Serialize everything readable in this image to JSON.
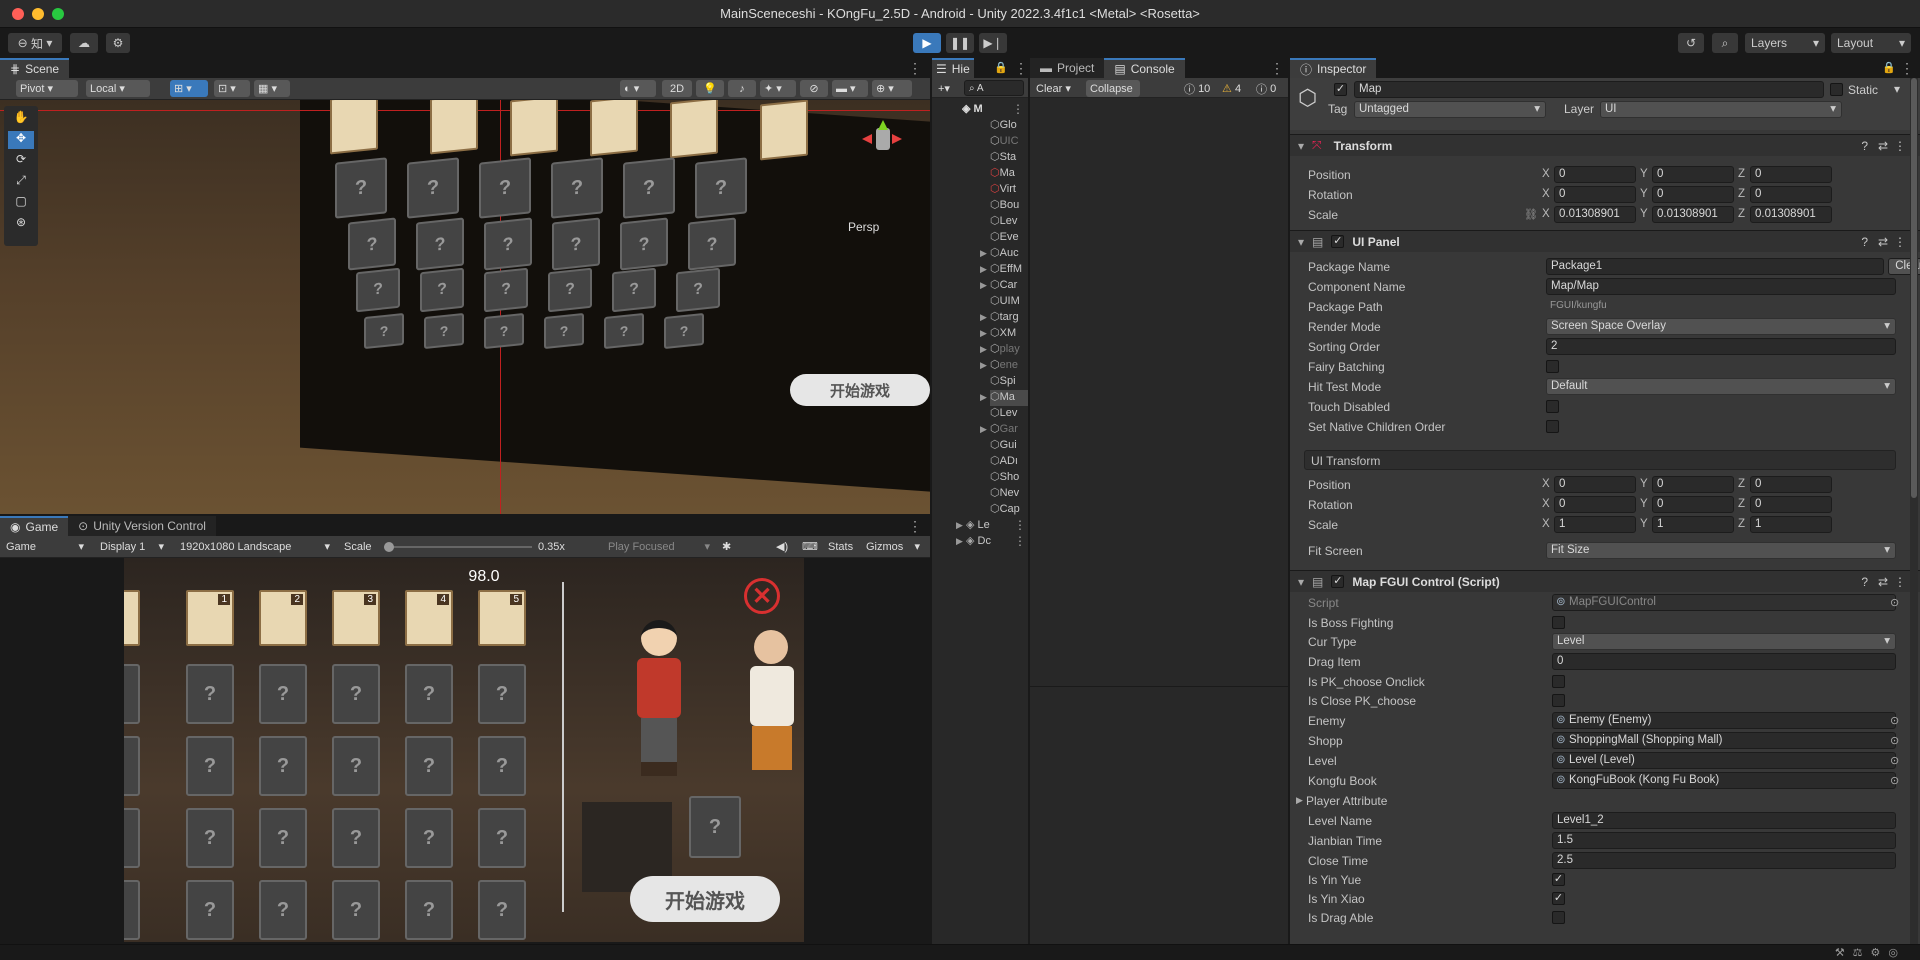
{
  "window": {
    "title": "MainSceneceshi - KOngFu_2.5D - Android - Unity 2022.3.4f1c1 <Metal> <Rosetta>"
  },
  "toolbar": {
    "account_label": "知",
    "layers_label": "Layers",
    "layout_label": "Layout"
  },
  "scene": {
    "tab_label": "Scene",
    "pivot_label": "Pivot",
    "local_label": "Local",
    "mode_2d_label": "2D",
    "persp_label": "Persp",
    "banner_text": "开始游戏"
  },
  "game": {
    "tab_label": "Game",
    "uvc_tab_label": "Unity Version Control",
    "view_label": "Game",
    "display_label": "Display 1",
    "resolution_label": "1920x1080 Landscape",
    "scale_label": "Scale",
    "scale_value": "0.35x",
    "play_focused_label": "Play Focused",
    "stats_label": "Stats",
    "gizmos_label": "Gizmos",
    "score_text": "98.0",
    "start_button_text": "开始游戏",
    "card_numbers": [
      "1",
      "2",
      "3",
      "4",
      "5"
    ],
    "unknown_glyph": "?"
  },
  "hierarchy": {
    "tab_label": "Hie",
    "search_placeholder": "A",
    "root_label": "M",
    "items": [
      "Glo",
      "UIC",
      "Sta",
      "Ma",
      "Virt",
      "Bou",
      "Lev",
      "Eve",
      "Auc",
      "EffM",
      "Car",
      "UIM",
      "targ",
      "XM",
      "play",
      "ene",
      "Spi",
      "Ma",
      "Lev",
      "Gar",
      "Gui",
      "ADı",
      "Sho",
      "Nev",
      "Cap"
    ],
    "bottom_items": [
      "Le",
      "Dc"
    ]
  },
  "project": {
    "tab_label": "Project"
  },
  "console": {
    "tab_label": "Console",
    "clear_label": "Clear",
    "collapse_label": "Collapse",
    "info_count": "10",
    "warning_count": "4",
    "error_count": "0"
  },
  "inspector": {
    "tab_label": "Inspector",
    "object_name": "Map",
    "static_label": "Static",
    "tag_label": "Tag",
    "tag_value": "Untagged",
    "layer_label": "Layer",
    "layer_value": "UI",
    "transform": {
      "title": "Transform",
      "position_label": "Position",
      "position": [
        "0",
        "0",
        "0"
      ],
      "rotation_label": "Rotation",
      "rotation": [
        "0",
        "0",
        "0"
      ],
      "scale_label": "Scale",
      "scale": [
        "0.01308901",
        "0.01308901",
        "0.01308901"
      ]
    },
    "axis_labels": [
      "X",
      "Y",
      "Z"
    ],
    "ui_panel": {
      "title": "UI Panel",
      "package_name_label": "Package Name",
      "package_name": "Package1",
      "clear_label": "Clear",
      "component_name_label": "Component Name",
      "component_name": "Map/Map",
      "package_path_label": "Package Path",
      "package_path": "FGUI/kungfu",
      "render_mode_label": "Render Mode",
      "render_mode": "Screen Space Overlay",
      "sorting_order_label": "Sorting Order",
      "sorting_order": "2",
      "fairy_batching_label": "Fairy Batching",
      "hit_test_mode_label": "Hit Test Mode",
      "hit_test_mode": "Default",
      "touch_disabled_label": "Touch Disabled",
      "native_order_label": "Set Native Children Order",
      "ui_transform_label": "UI Transform",
      "position_label": "Position",
      "position": [
        "0",
        "0",
        "0"
      ],
      "rotation_label": "Rotation",
      "rotation": [
        "0",
        "0",
        "0"
      ],
      "scale_label": "Scale",
      "scale": [
        "1",
        "1",
        "1"
      ],
      "fit_screen_label": "Fit Screen",
      "fit_screen": "Fit Size"
    },
    "map_control": {
      "title": "Map FGUI Control (Script)",
      "script_label": "Script",
      "script_value": "MapFGUIControl",
      "boss_label": "Is Boss Fighting",
      "cur_type_label": "Cur Type",
      "cur_type": "Level",
      "drag_item_label": "Drag Item",
      "drag_item": "0",
      "pk_onclick_label": "Is PK_choose Onclick",
      "close_pk_label": "Is Close PK_choose",
      "enemy_label": "Enemy",
      "enemy": "Enemy (Enemy)",
      "shopp_label": "Shopp",
      "shopp": "ShoppingMall (Shopping Mall)",
      "level_label": "Level",
      "level": "Level (Level)",
      "kongfu_label": "Kongfu Book",
      "kongfu": "KongFuBook (Kong Fu Book)",
      "player_attr_label": "Player Attribute",
      "level_name_label": "Level Name",
      "level_name": "Level1_2",
      "jianbian_label": "Jianbian Time",
      "jianbian": "1.5",
      "close_time_label": "Close Time",
      "close_time": "2.5",
      "yin_yue_label": "Is Yin Yue",
      "yin_xiao_label": "Is Yin Xiao",
      "drag_able_label": "Is Drag Able",
      "check_mark": "✓"
    }
  },
  "colors": {
    "accent": "#3a79bb",
    "panel": "#282828",
    "header": "#3c3c3c",
    "warning": "#e8b33a",
    "close_red": "#d83030"
  }
}
